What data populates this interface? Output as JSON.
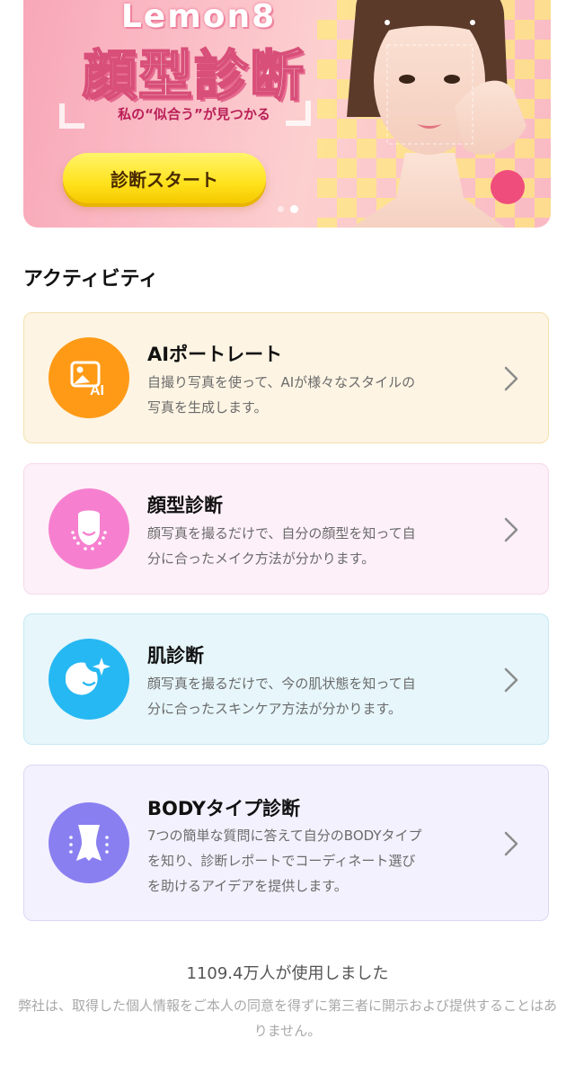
{
  "banner": {
    "brand": "Lemon8",
    "headline": "顔型診断",
    "tagline": "私の“似合う”が見つかる",
    "cta_label": "診断スタート",
    "colors": {
      "pink": "#f8a7b8",
      "yellow": "#ffe21d",
      "accent": "#ef4d7c"
    }
  },
  "section": {
    "title": "アクティビティ"
  },
  "activities": [
    {
      "title": "AIポートレート",
      "description": "自撮り写真を使って、AIが様々なスタイルの\n写真を生成します。",
      "icon": "ai-image-icon",
      "icon_color": "#ff9a16"
    },
    {
      "title": "顔型診断",
      "description": "顔写真を撮るだけで、自分の顔型を知って自\n分に合ったメイク方法が分かります。",
      "icon": "face-shape-icon",
      "icon_color": "#f680cf"
    },
    {
      "title": "肌診断",
      "description": "顔写真を撮るだけで、今の肌状態を知って自\n分に合ったスキンケア方法が分かります。",
      "icon": "skin-sparkle-icon",
      "icon_color": "#26b8f2"
    },
    {
      "title": "BODYタイプ診断",
      "description": "7つの簡単な質問に答えて自分のBODYタイプ\nを知り、診断レポートでコーディネート選び\nを助けるアイデアを提供します。",
      "icon": "body-type-icon",
      "icon_color": "#8a7ff0"
    }
  ],
  "footer": {
    "usage_count": "1109.4万人が使用しました",
    "privacy_note": "弊社は、取得した個人情報をご本人の同意を得ずに第三者に開示および提供することはありません。"
  }
}
